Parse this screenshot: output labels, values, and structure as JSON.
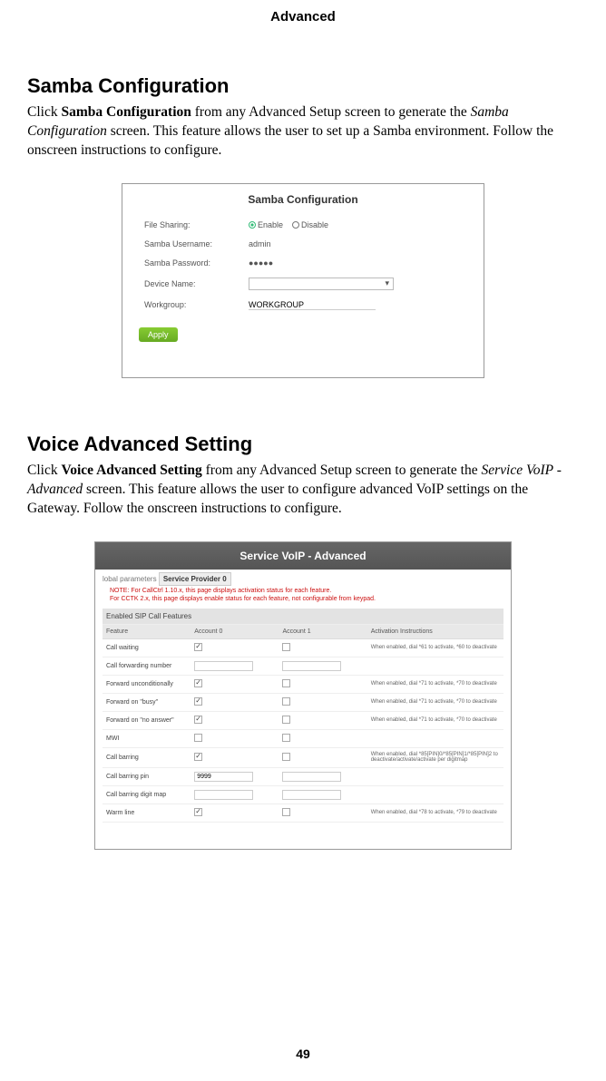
{
  "header": "Advanced",
  "samba": {
    "heading": "Samba Configuration",
    "para_prefix": "Click ",
    "para_bold": "Samba Configuration",
    "para_mid": " from any Advanced Setup screen to generate the ",
    "para_italic": "Samba Configuration",
    "para_suffix": " screen. This feature allows the user to set up a Samba environment. Follow the onscreen instructions to configure.",
    "ss": {
      "title": "Samba Configuration",
      "file_sharing_label": "File Sharing:",
      "enable": "Enable",
      "disable": "Disable",
      "username_label": "Samba Username:",
      "username_value": "admin",
      "password_label": "Samba Password:",
      "password_value": "●●●●●",
      "device_label": "Device Name:",
      "workgroup_label": "Workgroup:",
      "workgroup_value": "WORKGROUP",
      "apply": "Apply"
    }
  },
  "voice": {
    "heading": "Voice Advanced Setting",
    "para_prefix": "Click ",
    "para_bold": "Voice Advanced Setting",
    "para_mid": " from any Advanced Setup screen to generate the ",
    "para_italic": "Service VoIP - Advanced",
    "para_suffix": " screen. This feature allows the user to configure advanced VoIP settings on the Gateway. Follow the onscreen instructions to configure.",
    "ss": {
      "title": "Service VoIP - Advanced",
      "tab_global": "lobal parameters",
      "tab_active": "Service Provider 0",
      "note1": "NOTE: For CallCtrl 1.10.x, this page displays activation status for each feature.",
      "note2": "For CCTK 2.x, this page displays enable status for each feature, not configurable from keypad.",
      "section_head": "Enabled SIP Call Features",
      "col_feature": "Feature",
      "col_acc0": "Account 0",
      "col_acc1": "Account 1",
      "col_instr": "Activation Instructions",
      "rows": [
        {
          "feature": "Call waiting",
          "a0": true,
          "a1": false,
          "instr": "When enabled, dial *61 to activate, *60 to deactivate"
        },
        {
          "feature": "Call forwarding number",
          "a0": "input",
          "a1": "input",
          "instr": ""
        },
        {
          "feature": "Forward unconditionally",
          "a0": true,
          "a1": false,
          "instr": "When enabled, dial *71 to activate, *70 to deactivate"
        },
        {
          "feature": "Forward on \"busy\"",
          "a0": true,
          "a1": false,
          "instr": "When enabled, dial *71 to activate, *70 to deactivate"
        },
        {
          "feature": "Forward on \"no answer\"",
          "a0": true,
          "a1": false,
          "instr": "When enabled, dial *71 to activate, *70 to deactivate"
        },
        {
          "feature": "MWI",
          "a0": false,
          "a1": false,
          "instr": ""
        },
        {
          "feature": "Call barring",
          "a0": true,
          "a1": false,
          "instr": "When enabled, dial *85[PIN]0/*85[PIN]1/*85[PIN]2 to deactivate/activate/activate per digitmap"
        },
        {
          "feature": "Call barring pin",
          "a0": "9999",
          "a1": "input",
          "instr": ""
        },
        {
          "feature": "Call barring digit map",
          "a0": "input",
          "a1": "input",
          "instr": ""
        },
        {
          "feature": "Warm line",
          "a0": true,
          "a1": false,
          "instr": "When enabled, dial *78 to activate, *79 to deactivate"
        }
      ]
    }
  },
  "page_number": "49"
}
